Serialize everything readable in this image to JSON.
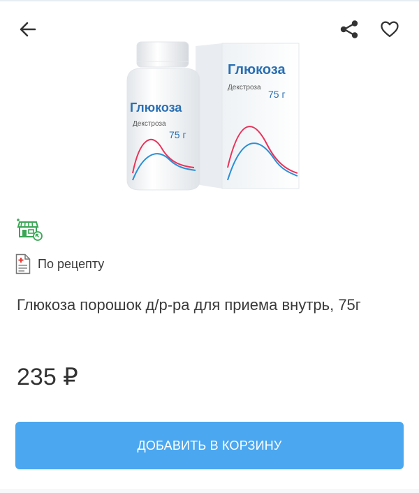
{
  "header": {
    "back_icon": "arrow-left-icon",
    "share_icon": "share-icon",
    "favorite_icon": "heart-outline-icon"
  },
  "product": {
    "image_texts": {
      "brand": "Глюкоза",
      "substance": "Декстроза",
      "dose": "75 г"
    },
    "availability_icon": "store-pickup-icon",
    "prescription_icon": "prescription-document-icon",
    "prescription_label": "По рецепту",
    "title": "Глюкоза порошок д/р-ра для приема внутрь, 75г",
    "price": "235 ₽"
  },
  "actions": {
    "add_to_cart_label": "ДОБАВИТЬ В КОРЗИНУ"
  },
  "colors": {
    "accent": "#4ba7ef",
    "availability_green": "#3aa655",
    "prescription_red": "#e53935",
    "brand_blue": "#2a6fb3",
    "curve_red": "#e8335a",
    "curve_blue": "#2a8fd6"
  }
}
